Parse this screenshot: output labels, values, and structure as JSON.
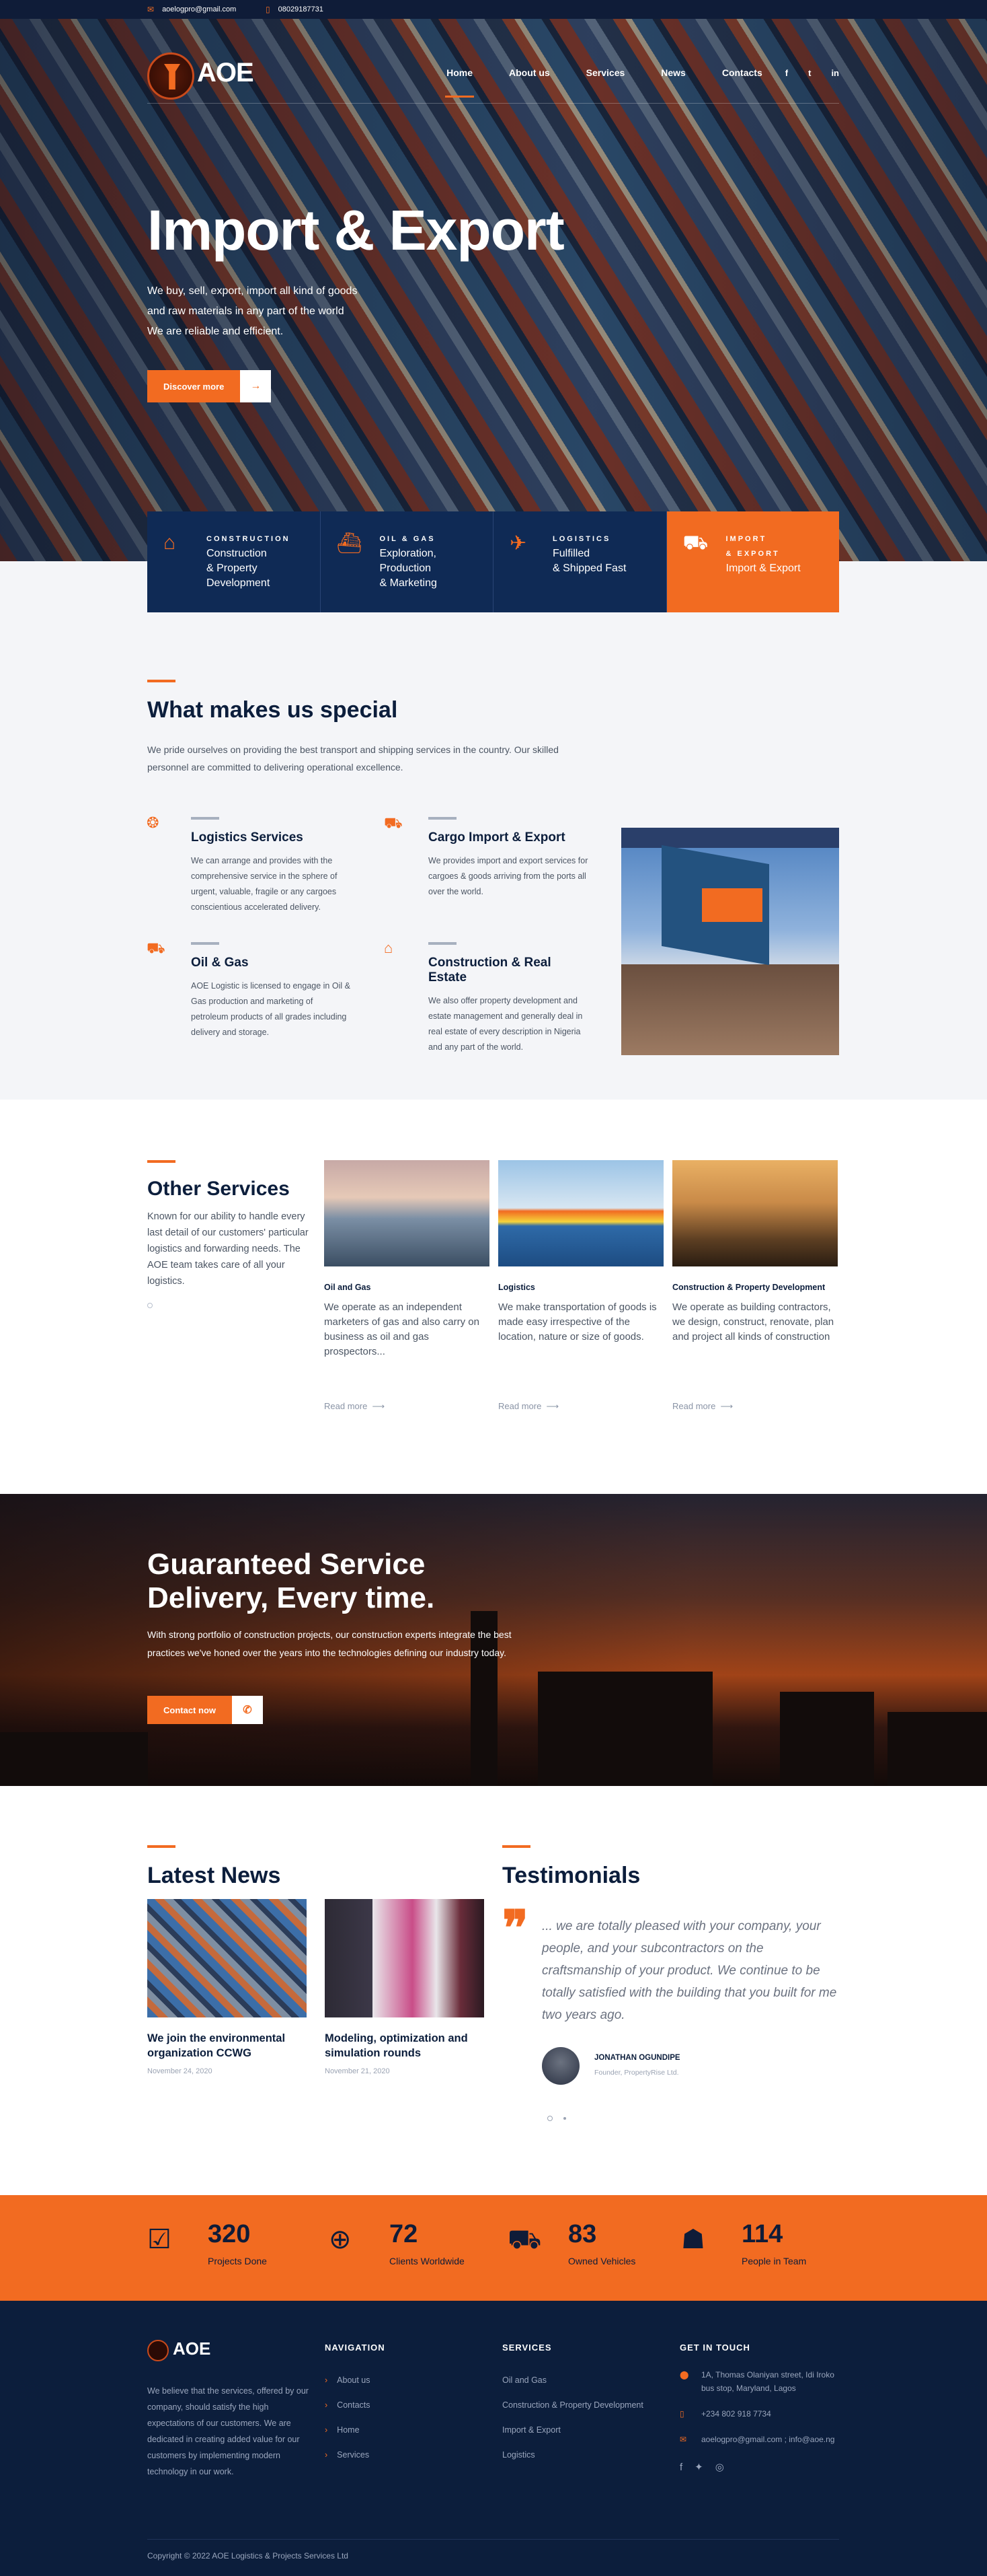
{
  "topbar": {
    "email": "aoelogpro@gmail.com",
    "phone": "08029187731"
  },
  "brand": {
    "logo_text": "AOE"
  },
  "nav": {
    "items": [
      "Home",
      "About us",
      "Services",
      "News",
      "Contacts"
    ],
    "social": [
      "f",
      "t",
      "in"
    ]
  },
  "hero": {
    "title": "Import & Export",
    "lead": [
      "We buy, sell, export, import all kind of goods",
      "and raw materials in any part of the world",
      "We are reliable and efficient."
    ],
    "cta": "Discover more"
  },
  "features": [
    {
      "kicker": "CONSTRUCTION",
      "text": "Construction\n& Property\nDevelopment",
      "icon": "house-icon"
    },
    {
      "kicker": "OIL & GAS",
      "text": "Exploration,\nProduction\n& Marketing",
      "icon": "ship-icon"
    },
    {
      "kicker": "LOGISTICS",
      "text": "Fulfilled\n& Shipped Fast",
      "icon": "plane-icon"
    },
    {
      "kicker": "IMPORT\n& EXPORT",
      "text": "Import & Export",
      "icon": "forklift-icon"
    }
  ],
  "special": {
    "title": "What makes us special",
    "text": "We pride ourselves on providing the best transport and shipping services in the country. Our skilled personnel are committed to delivering operational excellence.",
    "services": [
      {
        "title": "Logistics Services",
        "text": "We can arrange and provides with the comprehensive service in the sphere of urgent, valuable, fragile or any cargoes conscientious accelerated delivery."
      },
      {
        "title": "Cargo Import & Export",
        "text": "We provides import and export services for cargoes & goods arriving from the ports all over the world."
      },
      {
        "title": "Oil & Gas",
        "text": "AOE Logistic is licensed to engage in Oil & Gas production and marketing of petroleum products of all grades including delivery and storage."
      },
      {
        "title": "Construction & Real Estate",
        "text": "We also offer property development and estate management and generally deal in real estate of every description in Nigeria and any part of the world."
      }
    ]
  },
  "other": {
    "title": "Other Services",
    "text": "Known for our ability to handle every last detail of our customers' particular logistics and forwarding needs. The AOE team takes care of all your logistics.",
    "cards": [
      {
        "cat": "Oil and Gas",
        "text": "We operate as an independent marketers of gas and also carry on business as oil and gas prospectors...",
        "more": "Read more"
      },
      {
        "cat": "Logistics",
        "text": "We make transportation of goods is made easy irrespective of the location, nature or size of goods.",
        "more": "Read more"
      },
      {
        "cat": "Construction & Property Development",
        "text": "We operate as building contractors, we design, construct, renovate, plan and project all kinds of construction",
        "more": "Read more"
      }
    ]
  },
  "guarantee": {
    "title_1": "Guaranteed Service",
    "title_2": "Delivery, Every time.",
    "text": "With strong portfolio of construction projects, our construction experts integrate the best practices we've honed over the years into the technologies defining our industry today.",
    "cta": "Contact now"
  },
  "news": {
    "title": "Latest News",
    "items": [
      {
        "title": "We join the environmental organization CCWG",
        "date": "November 24, 2020"
      },
      {
        "title": "Modeling, optimization and simulation rounds",
        "date": "November 21, 2020"
      }
    ]
  },
  "testimonials": {
    "title": "Testimonials",
    "quote": "... we are totally pleased with your company, your people, and your subcontractors on the craftsmanship of your product. We continue to be totally satisfied with the building that you built for me two years ago.",
    "name": "JONATHAN OGUNDIPE",
    "role": "Founder, PropertyRise Ltd."
  },
  "stats": [
    {
      "num": "320",
      "label": "Projects Done",
      "icon": "clipboard-icon"
    },
    {
      "num": "72",
      "label": "Clients Worldwide",
      "icon": "globe-icon"
    },
    {
      "num": "83",
      "label": "Owned Vehicles",
      "icon": "truck-icon"
    },
    {
      "num": "114",
      "label": "People in Team",
      "icon": "team-icon"
    }
  ],
  "footer": {
    "about": "We believe that the services, offered by our company, should satisfy the high expectations of our customers. We are dedicated in creating added value for our customers by implementing modern technology in our work.",
    "nav_title": "NAVIGATION",
    "nav": [
      "About us",
      "Contacts",
      "Home",
      "Services"
    ],
    "svc_title": "SERVICES",
    "svc": [
      "Oil and Gas",
      "Construction & Property Development",
      "Import & Export",
      "Logistics"
    ],
    "contact_title": "GET IN TOUCH",
    "address": "1A, Thomas Olaniyan street, Idi Iroko bus stop, Maryland, Lagos",
    "phone": "+234 802 918 7734",
    "email": "aoelogpro@gmail.com ; info@aoe.ng",
    "copyright": "Copyright © 2022 AOE Logistics & Projects Services Ltd"
  },
  "colors": {
    "accent": "#f26b21",
    "navy": "#0c1e3c"
  }
}
